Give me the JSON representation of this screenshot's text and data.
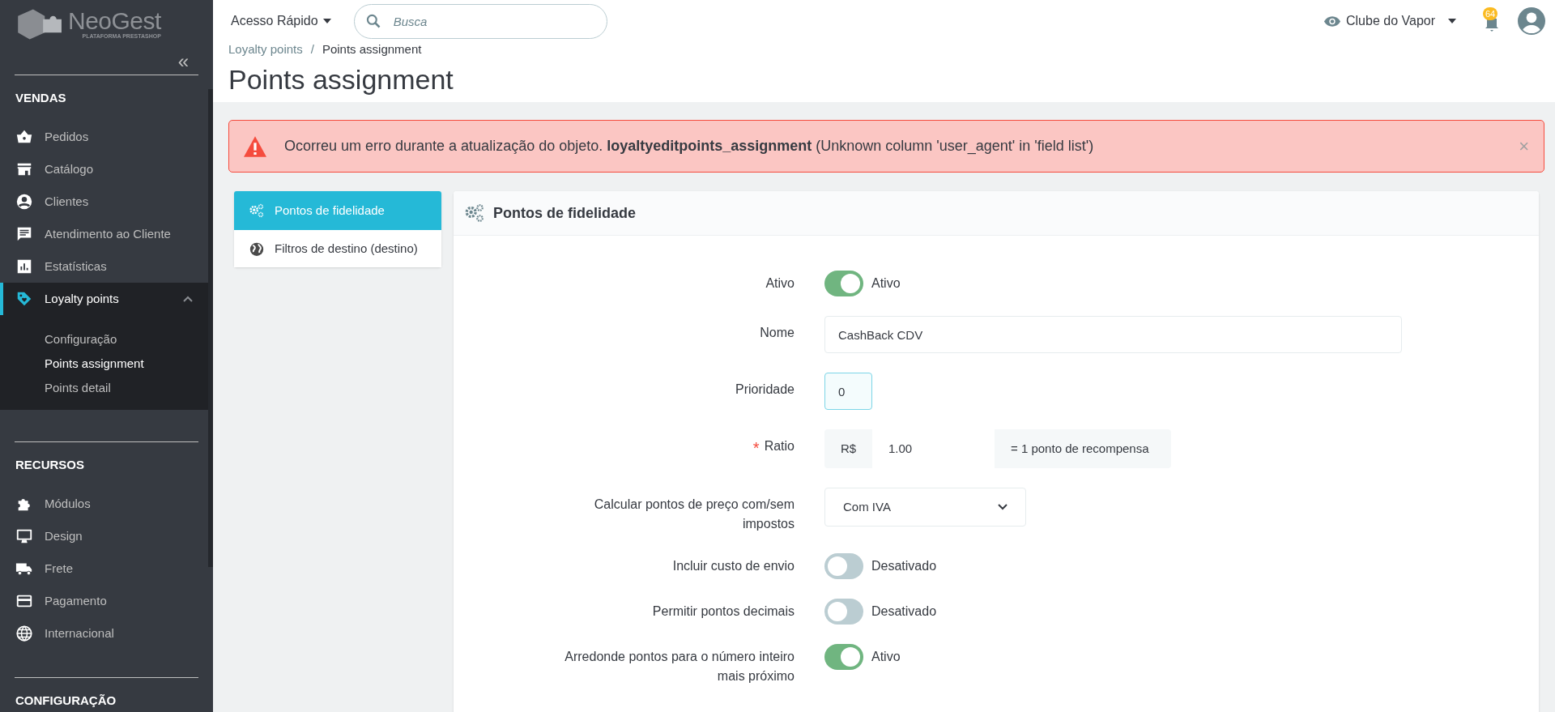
{
  "logo": {
    "name": "NeoGest",
    "tagline": "PLATAFORMA PRESTASHOP"
  },
  "sidebar": {
    "collapse": "«",
    "sections": [
      {
        "title": "VENDAS",
        "items": [
          {
            "label": "Pedidos",
            "selected": false
          },
          {
            "label": "Catálogo",
            "selected": false
          },
          {
            "label": "Clientes",
            "selected": false
          },
          {
            "label": "Atendimento ao Cliente",
            "selected": false
          },
          {
            "label": "Estatísticas",
            "selected": false
          },
          {
            "label": "Loyalty points",
            "selected": true,
            "expanded": true,
            "children": [
              {
                "label": "Configuração",
                "selected": false
              },
              {
                "label": "Points assignment",
                "selected": true
              },
              {
                "label": "Points detail",
                "selected": false
              }
            ]
          }
        ]
      },
      {
        "title": "RECURSOS",
        "items": [
          {
            "label": "Módulos",
            "selected": false
          },
          {
            "label": "Design",
            "selected": false
          },
          {
            "label": "Frete",
            "selected": false
          },
          {
            "label": "Pagamento",
            "selected": false
          },
          {
            "label": "Internacional",
            "selected": false
          }
        ]
      },
      {
        "title": "CONFIGURAÇÃO"
      }
    ]
  },
  "header": {
    "quick_access": "Acesso Rápido",
    "search": {
      "placeholder": "Busca"
    },
    "shop": "Clube do Vapor",
    "notifications": "64"
  },
  "breadcrumb": {
    "separator": "/",
    "items": [
      "Loyalty points",
      "Points assignment"
    ]
  },
  "title": "Points assignment",
  "alert": {
    "text": "Ocorreu um erro durante a atualização do objeto. **loyaltyeditpoints_assignment** (Unknown column 'user_agent' in 'field list')",
    "close": "×"
  },
  "tabs": [
    {
      "label": "Pontos de fidelidade",
      "selected": true
    },
    {
      "label": "Filtros de destino (destino)",
      "selected": false
    }
  ],
  "panel": {
    "title": "Pontos de fidelidade",
    "required_mark": "*",
    "fields": [
      {
        "kind": "switch",
        "label": "Ativo",
        "required": false,
        "on": true,
        "state_label": "Ativo"
      },
      {
        "kind": "text",
        "label": "Nome",
        "required": false,
        "value": "CashBack CDV",
        "focused": false
      },
      {
        "kind": "short_text",
        "label": "Prioridade",
        "required": false,
        "value": "0",
        "focused": true
      },
      {
        "kind": "input_group",
        "label": "Ratio",
        "required": true,
        "prefix": "R$",
        "value": "1.00",
        "suffix": "= 1 ponto de recompensa"
      },
      {
        "kind": "select",
        "label": "Calcular pontos de preço com/sem impostos",
        "required": false,
        "value": "Com IVA"
      },
      {
        "kind": "switch",
        "label": "Incluir custo de envio",
        "required": false,
        "on": false,
        "state_label": "Desativado"
      },
      {
        "kind": "switch",
        "label": "Permitir pontos decimais",
        "required": false,
        "on": false,
        "state_label": "Desativado"
      },
      {
        "kind": "switch",
        "label": "Arredonde pontos para o número inteiro mais próximo",
        "required": false,
        "on": true,
        "state_label": "Ativo"
      }
    ]
  }
}
